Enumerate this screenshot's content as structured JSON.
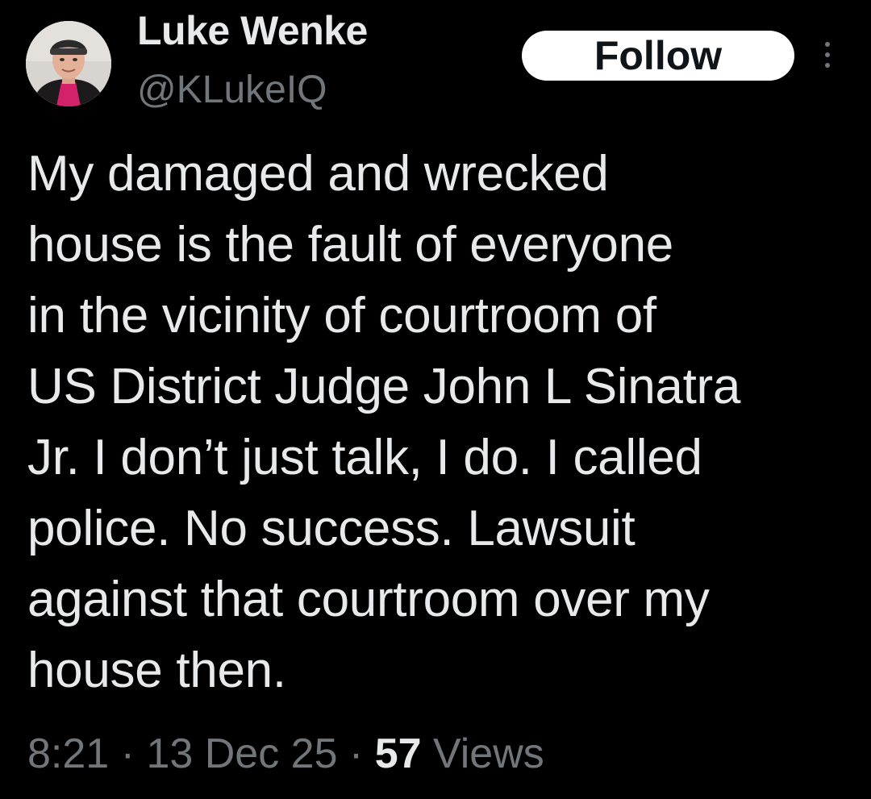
{
  "author": {
    "display_name": "Luke Wenke",
    "handle": "@KLukeIQ"
  },
  "actions": {
    "follow_label": "Follow",
    "more_icon": "more-vertical-icon"
  },
  "tweet": {
    "text": "My damaged and wrecked\nhouse is the fault of everyone\nin the vicinity of courtroom of\nUS District Judge John L Sinatra\nJr.  I don’t just talk, I do.  I called\npolice.  No success.  Lawsuit\nagainst that courtroom over my\nhouse then."
  },
  "meta": {
    "time": "8:21",
    "separator": " · ",
    "date": "13 Dec 25",
    "views_count": "57",
    "views_label": " Views"
  },
  "colors": {
    "background": "#000000",
    "primary_text": "#e7e9ea",
    "secondary_text": "#71767b",
    "follow_bg": "#ffffff",
    "follow_text": "#0f1419"
  }
}
